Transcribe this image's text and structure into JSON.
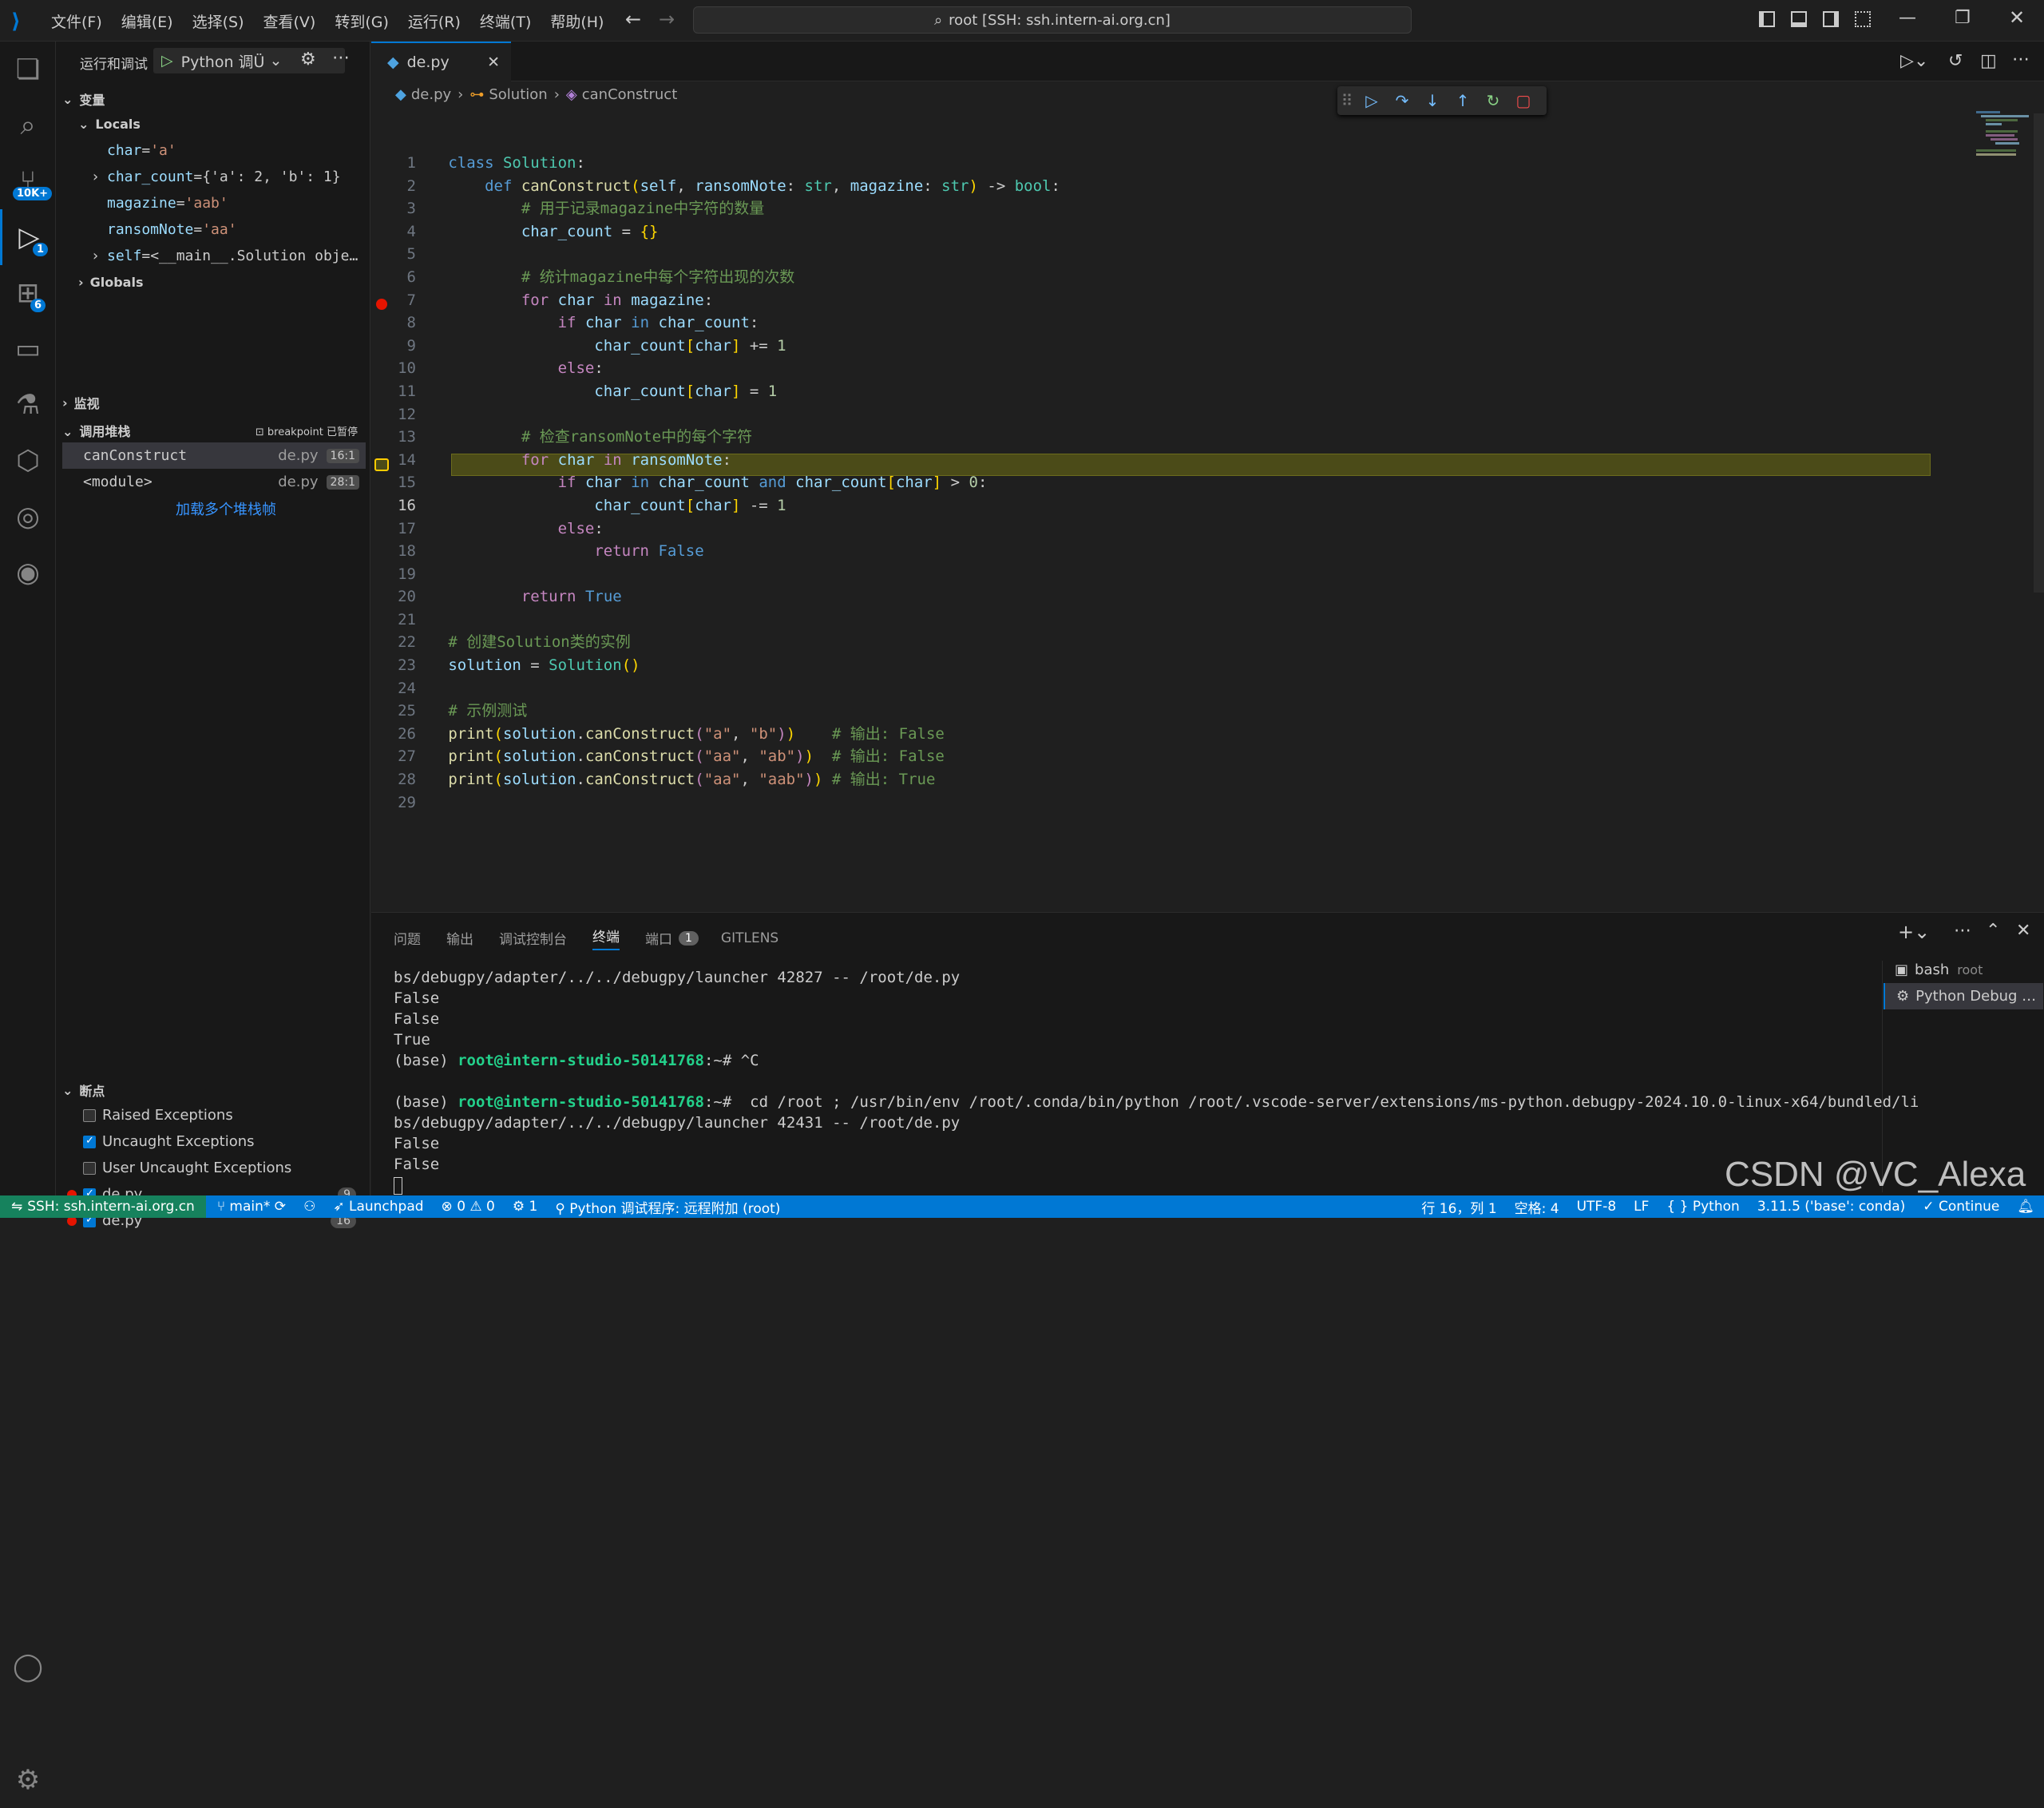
{
  "titlebar": {
    "menu": [
      "文件(F)",
      "编辑(E)",
      "选择(S)",
      "查看(V)",
      "转到(G)",
      "运行(R)",
      "终端(T)",
      "帮助(H)"
    ],
    "search_text": "root [SSH: ssh.intern-ai.org.cn]"
  },
  "activity": {
    "badges": {
      "scm": "10K+",
      "debug": "1",
      "extensions": "6"
    }
  },
  "sidebar": {
    "run_label": "运行和调试",
    "config_name": "Python 调Ü",
    "variables_title": "变量",
    "locals_title": "Locals",
    "locals": [
      {
        "name": "char",
        "value": "'a'",
        "expandable": false
      },
      {
        "name": "char_count",
        "value": "{'a': 2, 'b': 1}",
        "expandable": true
      },
      {
        "name": "magazine",
        "value": "'aab'",
        "expandable": false
      },
      {
        "name": "ransomNote",
        "value": "'aa'",
        "expandable": false
      },
      {
        "name": "self",
        "value": "<__main__.Solution obje…",
        "expandable": true
      }
    ],
    "globals_title": "Globals",
    "watch_title": "监视",
    "callstack_title": "调用堆栈",
    "callstack_status": "breakpoint 已暂停",
    "frames": [
      {
        "name": "canConstruct",
        "file": "de.py",
        "pos": "16:1"
      },
      {
        "name": "<module>",
        "file": "de.py",
        "pos": "28:1"
      }
    ],
    "load_more": "加载多个堆栈帧",
    "breakpoints_title": "断点",
    "breakpoints": [
      {
        "label": "Raised Exceptions",
        "checked": false,
        "dot": false,
        "count": ""
      },
      {
        "label": "Uncaught Exceptions",
        "checked": true,
        "dot": false,
        "count": ""
      },
      {
        "label": "User Uncaught Exceptions",
        "checked": false,
        "dot": false,
        "count": ""
      },
      {
        "label": "de.py",
        "checked": true,
        "dot": true,
        "count": "9"
      },
      {
        "label": "de.py",
        "checked": true,
        "dot": true,
        "count": "16"
      }
    ]
  },
  "editor": {
    "tab_name": "de.py",
    "breadcrumb": [
      "de.py",
      "Solution",
      "canConstruct"
    ],
    "current_line": 16,
    "breakpoint_line": 9
  },
  "panel": {
    "tabs": [
      "问题",
      "输出",
      "调试控制台",
      "终端",
      "端口",
      "GITLENS"
    ],
    "active_tab": "终端",
    "ports_badge": "1",
    "terminals": [
      {
        "name": "bash",
        "sub": "root"
      },
      {
        "name": "Python Debug …",
        "sub": ""
      }
    ],
    "lines": [
      "bs/debugpy/adapter/../../debugpy/launcher 42827 -- /root/de.py",
      "False",
      "False",
      "True",
      "",
      "",
      "bs/debugpy/adapter/../../debugpy/launcher 42431 -- /root/de.py",
      "False",
      "False"
    ],
    "prompt_base": "(base) ",
    "prompt_host": "root@intern-studio-50141768",
    "prompt_tail1": ":~# ^C",
    "prompt_tail2": ":~#  cd /root ; /usr/bin/env /root/.conda/bin/python /root/.vscode-server/extensions/ms-python.debugpy-2024.10.0-linux-x64/bundled/li"
  },
  "watermark": "CSDN @VC_Alexa",
  "statusbar": {
    "remote": "SSH: ssh.intern-ai.org.cn",
    "branch": "main*",
    "launchpad": "Launchpad",
    "problems": "0 ⚠ 0",
    "debug_sessions": "1",
    "debug_target": "Python 调试程序: 远程附加 (root)",
    "position": "行 16，列 1",
    "spaces": "空格: 4",
    "encoding": "UTF-8",
    "eol": "LF",
    "language": "Python",
    "interpreter": "3.11.5 ('base': conda)",
    "continue": "Continue"
  }
}
